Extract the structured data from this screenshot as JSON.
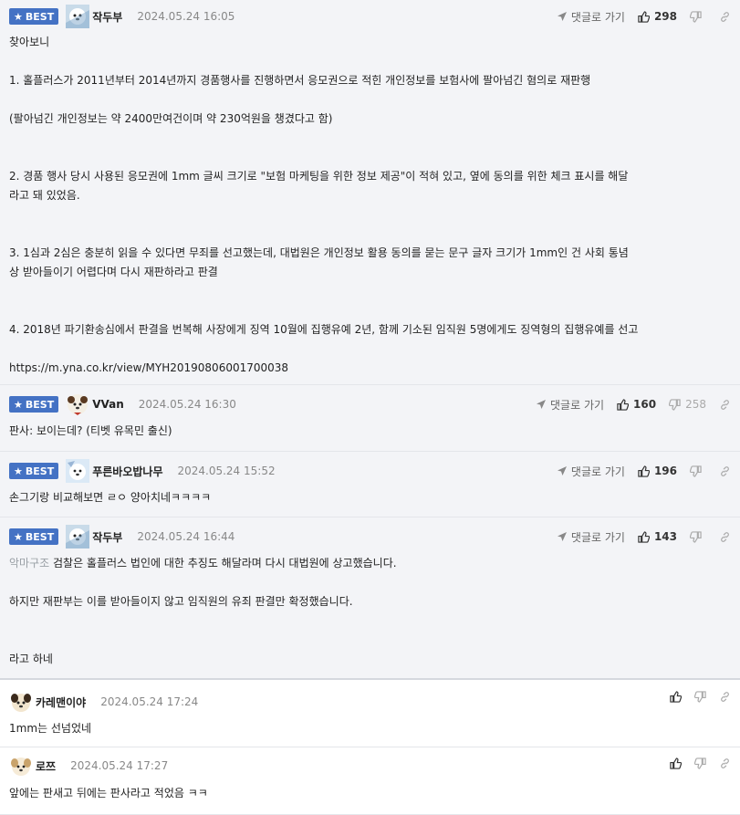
{
  "comments": [
    {
      "badge": "BEST",
      "author": "작두부",
      "date": "2024.05.24 16:05",
      "reply_label": "댓글로 가기",
      "up": "298",
      "down": "",
      "lines": [
        "찾아보니",
        "",
        "1. 홀플러스가 2011년부터 2014년까지 경품행사를 진행하면서 응모권으로 적힌 개인정보를 보험사에 팔아넘긴 혐의로 재판행",
        "",
        "(팔아넘긴 개인정보는 약 2400만여건이며 약 230억원을 챙겼다고 함)",
        "",
        "",
        "2. 경품 행사 당시 사용된 응모권에 1mm 글씨 크기로 \"보험 마케팅을 위한 정보 제공\"이 적혀 있고, 옆에 동의를 위한 체크 표시를 해달",
        "라고 돼 있었음.",
        "",
        "",
        "3. 1심과 2심은 충분히 읽을 수 있다면 무죄를 선고했는데, 대법원은 개인정보 활용 동의를 묻는 문구 글자 크기가 1mm인 건 사회 통념",
        "상 받아들이기 어렵다며 다시 재판하라고 판결",
        "",
        "",
        "4. 2018년 파기환송심에서 판결을 번복해 사장에게 징역 10월에 집행유예 2년, 함께 기소된 임직원 5명에게도 징역형의 집행유예를 선고",
        "",
        "https://m.yna.co.kr/view/MYH20190806001700038"
      ]
    },
    {
      "badge": "BEST",
      "author": "VVan",
      "date": "2024.05.24 16:30",
      "reply_label": "댓글로 가기",
      "up": "160",
      "down": "258",
      "lines": [
        "판사: 보이는데? (티벳 유목민 출신)"
      ]
    },
    {
      "badge": "BEST",
      "author": "푸른바오밥나무",
      "date": "2024.05.24 15:52",
      "reply_label": "댓글로 가기",
      "up": "196",
      "down": "",
      "lines": [
        "손그기랑 비교해보면 ㄹㅇ 양아치네ㅋㅋㅋㅋ"
      ]
    },
    {
      "badge": "BEST",
      "author": "작두부",
      "date": "2024.05.24 16:44",
      "reply_label": "댓글로 가기",
      "up": "143",
      "down": "",
      "quote": "악마구조",
      "lines": [
        "검찰은 홀플러스 법인에 대한 추징도 해달라며 다시 대법원에 상고했습니다.",
        "",
        "하지만 재판부는 이를 받아들이지 않고 임직원의 유죄 판결만 확정했습니다.",
        "",
        "",
        "라고 하네"
      ]
    },
    {
      "author": "카레맨이야",
      "date": "2024.05.24 17:24",
      "lines": [
        "1mm는 선넘었네"
      ]
    },
    {
      "author": "로쯔",
      "date": "2024.05.24 17:27",
      "lines": [
        "앞에는 판새고 뒤에는 판사라고 적었음 ㅋㅋ"
      ]
    }
  ]
}
